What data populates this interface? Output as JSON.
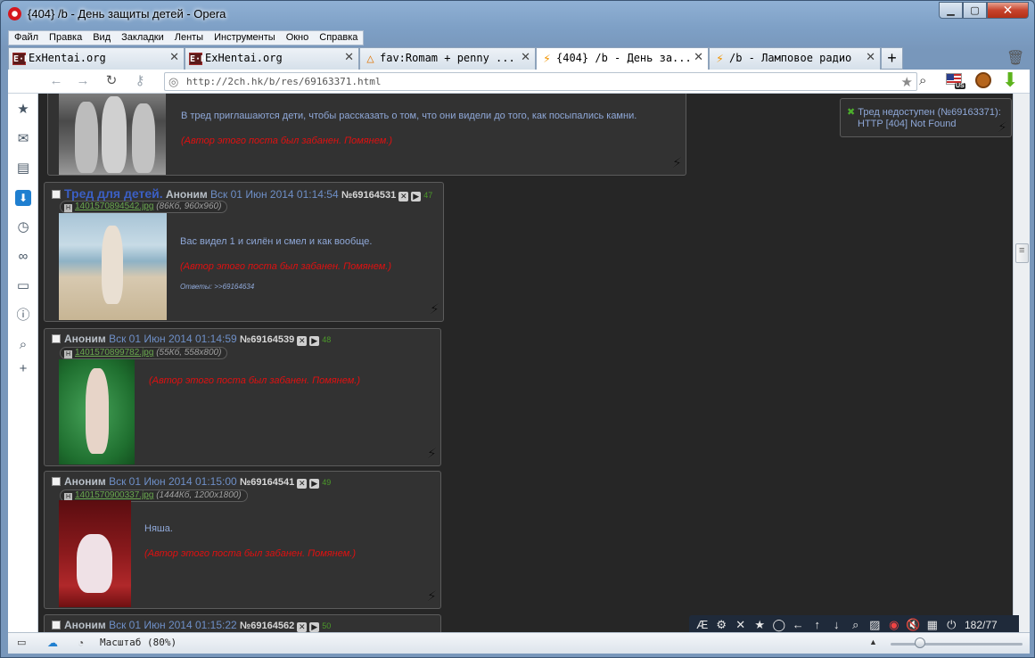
{
  "window": {
    "title": "{404} /b - День защиты детей - Opera"
  },
  "menu": [
    "Файл",
    "Правка",
    "Вид",
    "Закладки",
    "Ленты",
    "Инструменты",
    "Окно",
    "Справка"
  ],
  "tabs": [
    {
      "label": "ExHentai.org",
      "icon": "exhentai-icon",
      "active": false
    },
    {
      "label": "ExHentai.org",
      "icon": "exhentai-icon",
      "active": false
    },
    {
      "label": "fav:Romam + penny ...",
      "icon": "fav-icon",
      "active": false
    },
    {
      "label": "{404} /b - День за...",
      "icon": "bolt-icon",
      "active": true
    },
    {
      "label": "/b - Ламповое радио",
      "icon": "bolt-icon",
      "active": false
    }
  ],
  "address": {
    "url": "http://2ch.hk/b/res/69163371.html"
  },
  "locale_badge": "US",
  "notice": {
    "line1": "Тред недоступен (№69163371):",
    "line2": "HTTP [404] Not Found"
  },
  "posts": {
    "op_tail": {
      "text": "В тред приглашаются дети, чтобы рассказать о том, что они видели до того, как посыпались камни.",
      "ban": "(Автор этого поста был забанен. Помянем.)"
    },
    "p1": {
      "subject": "Тред для детей.",
      "name": "Аноним",
      "date": "Вск 01 Июн 2014 01:14:54",
      "num": "№69164531",
      "count": "47",
      "file": "1401570894542.jpg",
      "fsize": "(86Кб, 960x960)",
      "text": "Вас видел 1 и силён и смел и как вообще.",
      "ban": "(Автор этого поста был забанен. Помянем.)",
      "replies": "Ответы: >>69164634"
    },
    "p2": {
      "name": "Аноним",
      "date": "Вск 01 Июн 2014 01:14:59",
      "num": "№69164539",
      "count": "48",
      "file": "1401570899782.jpg",
      "fsize": "(55Кб, 558x800)",
      "ban": "(Автор этого поста был забанен. Помянем.)"
    },
    "p3": {
      "name": "Аноним",
      "date": "Вск 01 Июн 2014 01:15:00",
      "num": "№69164541",
      "count": "49",
      "file": "1401570900337.jpg",
      "fsize": "(1444Кб, 1200x1800)",
      "text": "Няша.",
      "ban": "(Автор этого поста был забанен. Помянем.)"
    },
    "p4": {
      "name": "Аноним",
      "date": "Вск 01 Июн 2014 01:15:22",
      "num": "№69164562",
      "count": "50"
    }
  },
  "post_counter": "182/77",
  "status": {
    "zoom": "Масштаб (80%)"
  },
  "colors": {
    "background": "#262626",
    "post": "#323232",
    "ban": "#e01010",
    "link": "#8fa8d8",
    "filename": "#6aa84f"
  }
}
